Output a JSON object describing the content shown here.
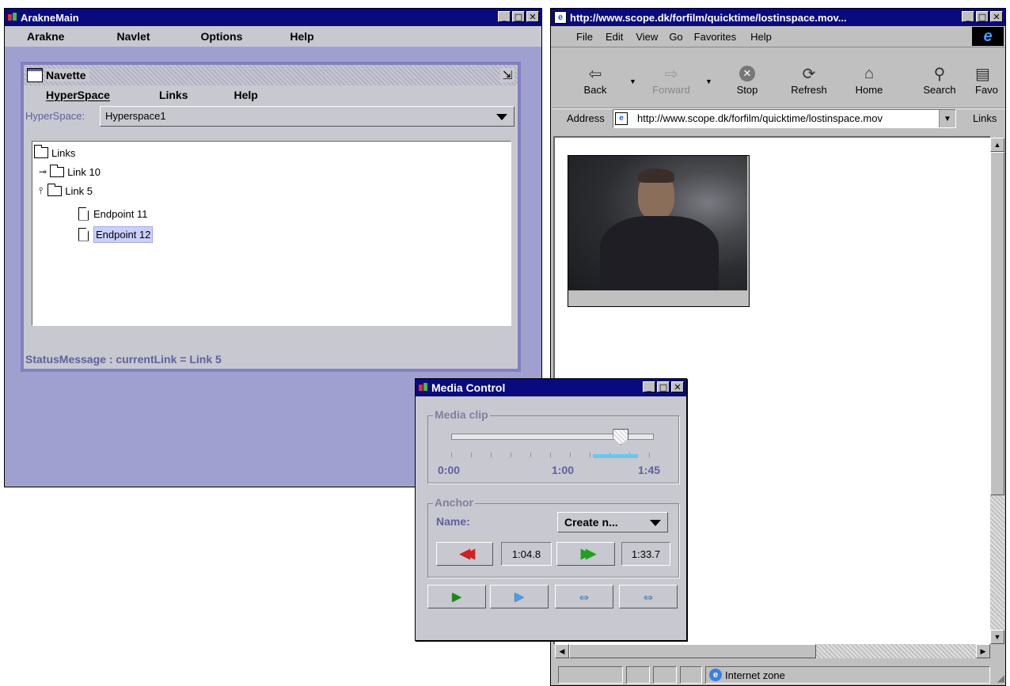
{
  "arakne": {
    "title": "ArakneMain",
    "menu": [
      "Arakne",
      "Navlet",
      "Options",
      "Help"
    ]
  },
  "navette": {
    "title": "Navette",
    "menu": [
      "HyperSpace",
      "Links",
      "Help"
    ],
    "hyperspace_label": "HyperSpace:",
    "hyperspace_value": "Hyperspace1",
    "tree": {
      "root": "Links",
      "link10": "Link 10",
      "link5": "Link 5",
      "endpoint11": "Endpoint 11",
      "endpoint12": "Endpoint 12"
    },
    "status": "StatusMessage : currentLink = Link 5"
  },
  "media": {
    "title": "Media Control",
    "clip_group": "Media clip",
    "slider_level": 0.84,
    "selection_range": [
      0.7,
      0.92
    ],
    "ticks": [
      "0:00",
      "1:00",
      "1:45"
    ],
    "anchor_group": "Anchor",
    "name_label": "Name:",
    "name_value": "Create n...",
    "start_time": "1:04.8",
    "end_time": "1:33.7"
  },
  "ie": {
    "title": "http://www.scope.dk/forfilm/quicktime/lostinspace.mov...",
    "menu": [
      "File",
      "Edit",
      "View",
      "Go",
      "Favorites",
      "Help"
    ],
    "toolbar": [
      "Back",
      "Forward",
      "Stop",
      "Refresh",
      "Home",
      "Search",
      "Favo"
    ],
    "address_label": "Address",
    "address_value": "http://www.scope.dk/forfilm/quicktime/lostinspace.mov",
    "links_label": "Links",
    "status_zone": "Internet zone"
  },
  "colors": {
    "title_active": "#0a0a80",
    "arakne_bg": "#a0a0d0",
    "panel": "#c8c8d0",
    "status_text": "#6060a0",
    "selection": "#c8d0ff"
  }
}
